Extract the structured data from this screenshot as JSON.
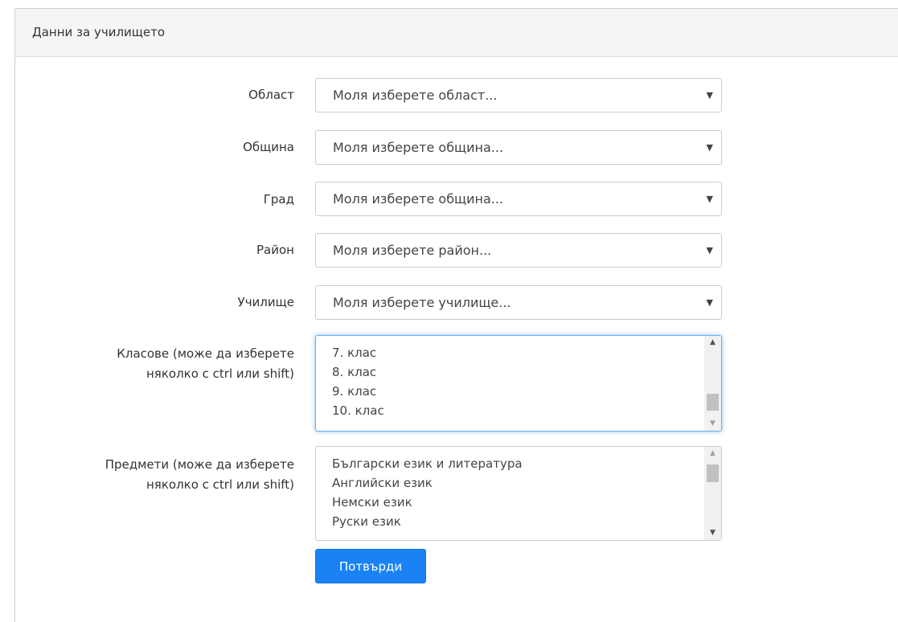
{
  "panel": {
    "title": "Данни за училището"
  },
  "fields": {
    "oblast": {
      "label": "Област",
      "placeholder": "Моля изберете област..."
    },
    "obshtina": {
      "label": "Община",
      "placeholder": "Моля изберете община..."
    },
    "grad": {
      "label": "Град",
      "placeholder": "Моля изберете община..."
    },
    "rayon": {
      "label": "Район",
      "placeholder": "Моля изберете район..."
    },
    "uchilishte": {
      "label": "Училище",
      "placeholder": "Моля изберете училище..."
    }
  },
  "classes": {
    "label_line1": "Класове (може да изберете",
    "label_line2": "няколко с ctrl или shift)",
    "options": [
      "7. клас",
      "8. клас",
      "9. клас",
      "10. клас"
    ]
  },
  "subjects": {
    "label_line1": "Предмети (може да изберете",
    "label_line2": "няколко с ctrl или shift)",
    "options": [
      "Български език и литература",
      "Английски език",
      "Немски език",
      "Руски език"
    ]
  },
  "submit": {
    "label": "Потвърди"
  },
  "colors": {
    "accent": "#1a82f5",
    "focus": "#66afe9",
    "panel_heading_bg": "#f5f5f5"
  }
}
